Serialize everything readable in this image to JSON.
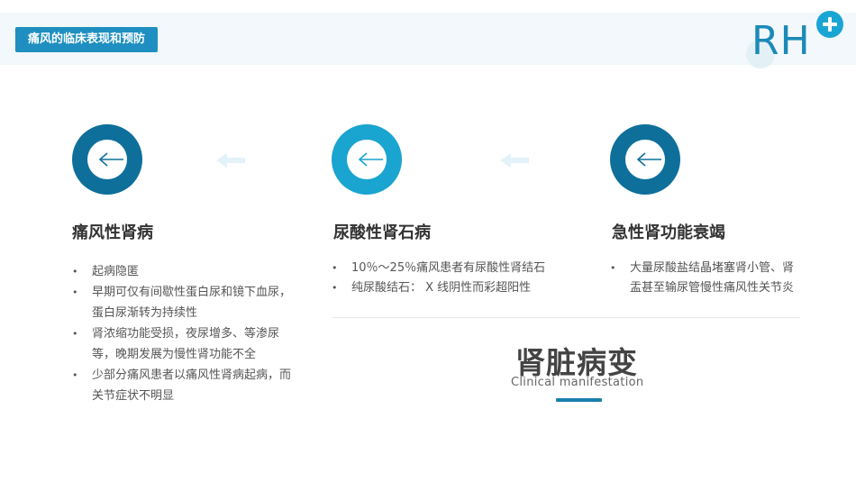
{
  "header": {
    "tag": "痛风的临床表现和预防",
    "logo_text": "RH"
  },
  "colors": {
    "primary_dark": "#0e6f9a",
    "primary_light": "#1aa4d0",
    "accent": "#1b7fae",
    "deco_arrow": "#e3f2f8"
  },
  "columns": [
    {
      "icon": "left-arrow-icon",
      "title": "痛风性肾病",
      "bullets": [
        "起病隐匿",
        "早期可仅有间歇性蛋白尿和镜下血尿，蛋白尿渐转为持续性",
        "肾浓缩功能受损，夜尿增多、等渗尿等，晚期发展为慢性肾功能不全",
        "少部分痛风患者以痛风性肾病起病，而关节症状不明显"
      ]
    },
    {
      "icon": "left-arrow-icon",
      "title": "尿酸性肾石病",
      "bullets": [
        "10％～25％痛风患者有尿酸性肾结石",
        "纯尿酸结石： X 线阴性而彩超阳性"
      ]
    },
    {
      "icon": "left-arrow-icon",
      "title": "急性肾功能衰竭",
      "bullets": [
        "大量尿酸盐结晶堵塞肾小管、肾盂甚至输尿管慢性痛风性关节炎"
      ]
    }
  ],
  "section": {
    "title": "肾脏病变",
    "subtitle": "Clinical manifestation"
  }
}
